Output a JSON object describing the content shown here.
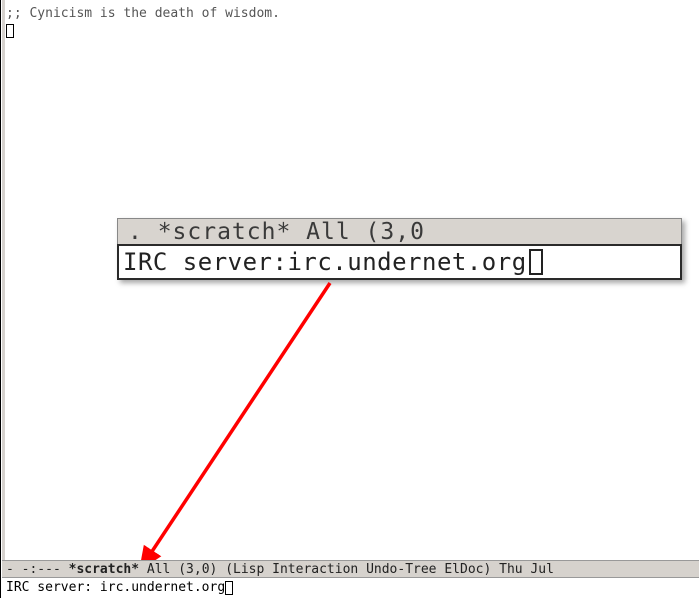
{
  "buffer": {
    "scratch_line": ";; Cynicism is the death of wisdom."
  },
  "inset": {
    "top_fragment": "  .      *scratch*       All (3,0",
    "prompt": "IRC server: ",
    "value": "irc.undernet.org"
  },
  "modeline": {
    "left": "- -:---  ",
    "buffer_name": "*scratch*",
    "spacer": "     ",
    "position": "All (3,0)",
    "modes": "(Lisp Interaction Undo-Tree ElDoc)",
    "time": "Thu Jul"
  },
  "minibuffer": {
    "prompt": "IRC server: ",
    "value": "irc.undernet.org"
  }
}
